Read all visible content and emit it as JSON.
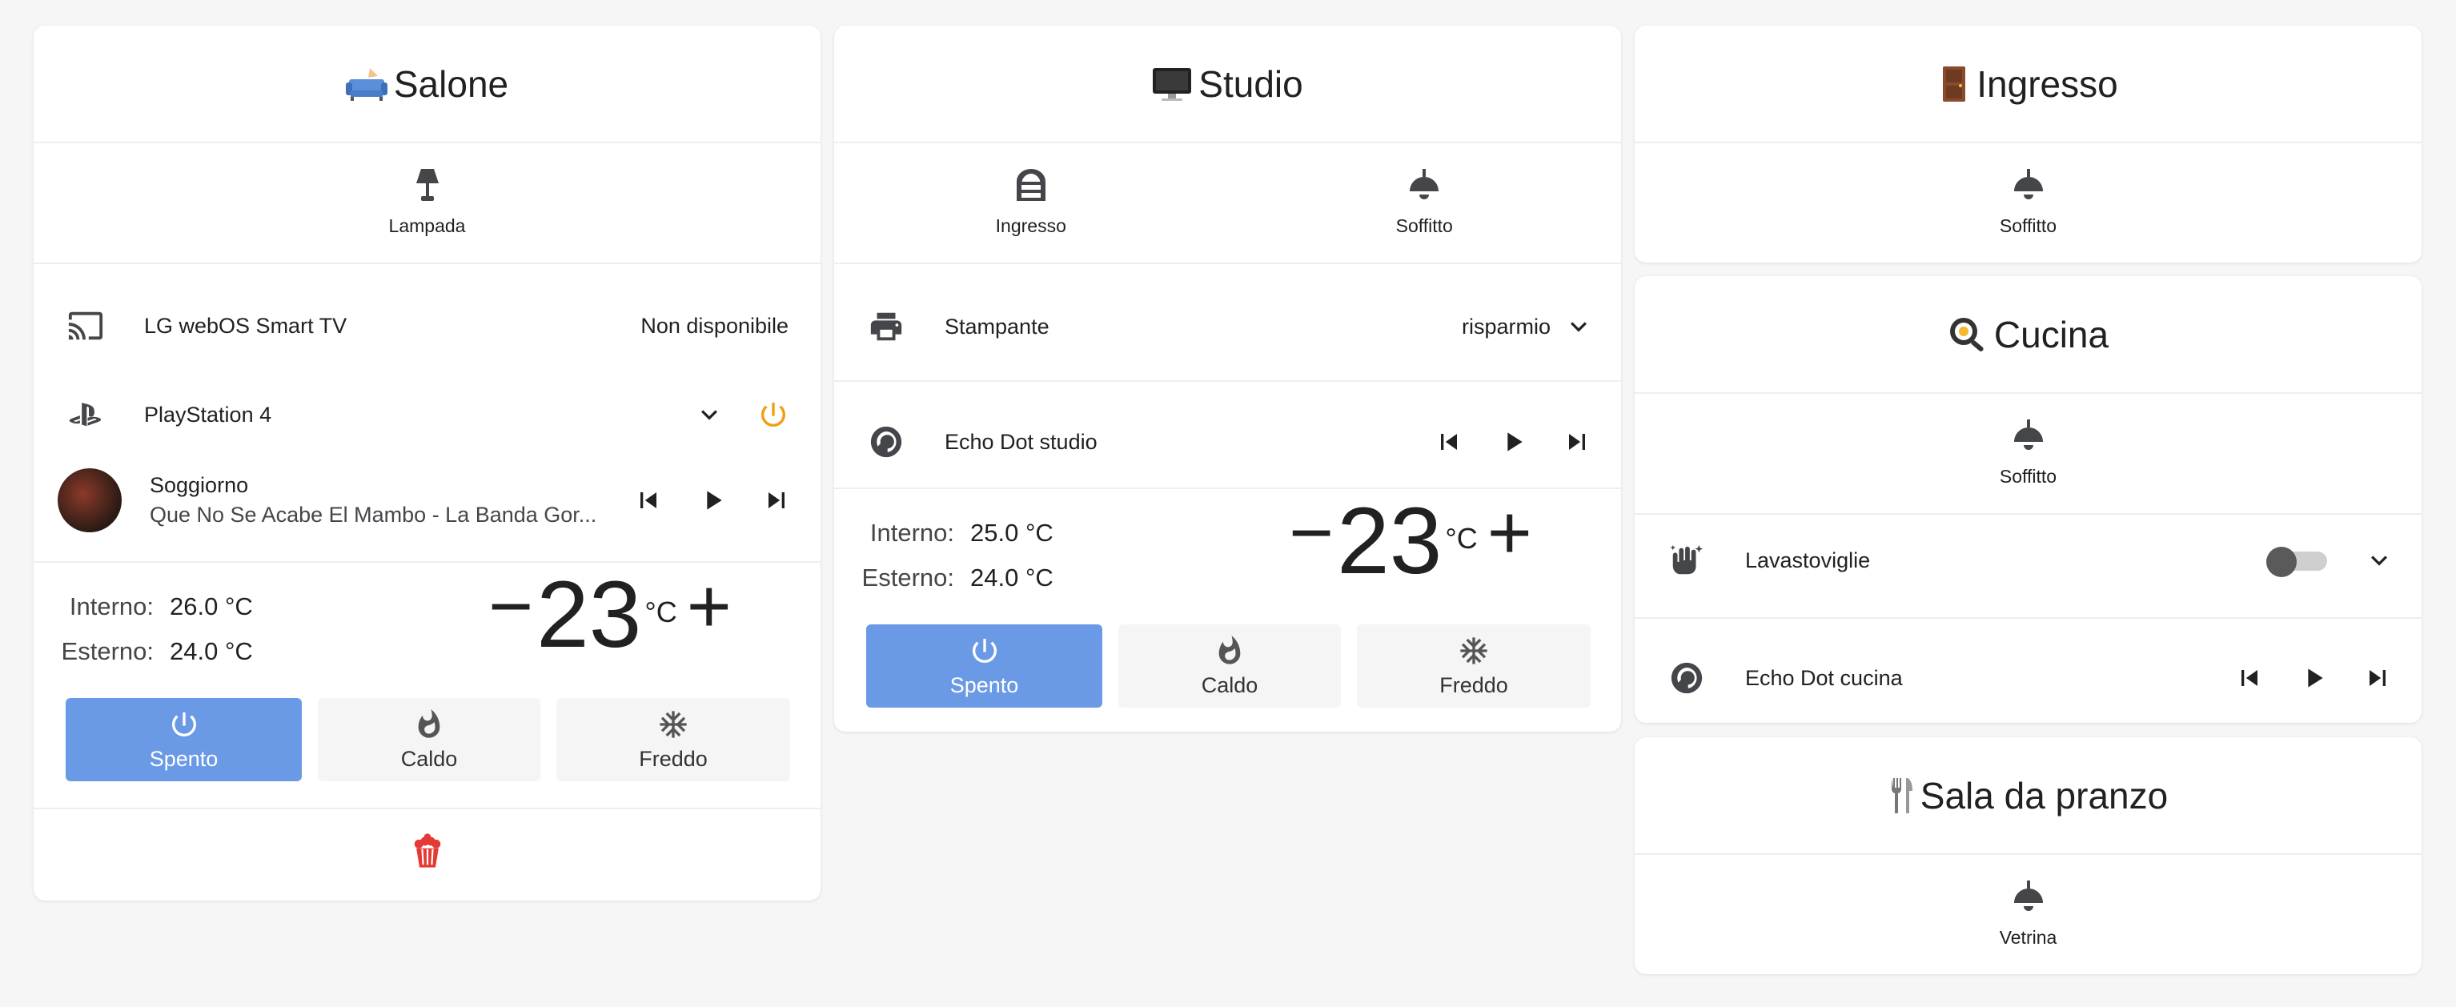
{
  "salone": {
    "title": "Salone",
    "lamp_label": "Lampada",
    "tv_name": "LG webOS Smart TV",
    "tv_state": "Non disponibile",
    "ps_name": "PlayStation 4",
    "media_name": "Soggiorno",
    "media_track": "Que No Se Acabe El Mambo - La Banda Gor...",
    "interno_label": "Interno:",
    "interno_value": "26.0 °C",
    "esterno_label": "Esterno:",
    "esterno_value": "24.0 °C",
    "setpoint_minus": "−",
    "setpoint": "23",
    "unit": "°C",
    "setpoint_plus": "+",
    "mode_off": "Spento",
    "mode_heat": "Caldo",
    "mode_cool": "Freddo"
  },
  "studio": {
    "title": "Studio",
    "btn1_label": "Ingresso",
    "btn2_label": "Soffitto",
    "printer_name": "Stampante",
    "printer_mode": "risparmio",
    "echo_name": "Echo Dot studio",
    "interno_label": "Interno:",
    "interno_value": "25.0 °C",
    "esterno_label": "Esterno:",
    "esterno_value": "24.0 °C",
    "setpoint_minus": "−",
    "setpoint": "23",
    "unit": "°C",
    "setpoint_plus": "+",
    "mode_off": "Spento",
    "mode_heat": "Caldo",
    "mode_cool": "Freddo"
  },
  "ingresso": {
    "title": "Ingresso",
    "btn_label": "Soffitto"
  },
  "cucina": {
    "title": "Cucina",
    "btn_label": "Soffitto",
    "dishwasher_name": "Lavastoviglie",
    "dishwasher_on": false,
    "echo_name": "Echo Dot cucina"
  },
  "sala": {
    "title": "Sala da pranzo",
    "btn_label": "Vetrina"
  },
  "colors": {
    "accent": "#6a9ae6",
    "power_orange": "#f39c12",
    "popcorn_red": "#e53935"
  }
}
